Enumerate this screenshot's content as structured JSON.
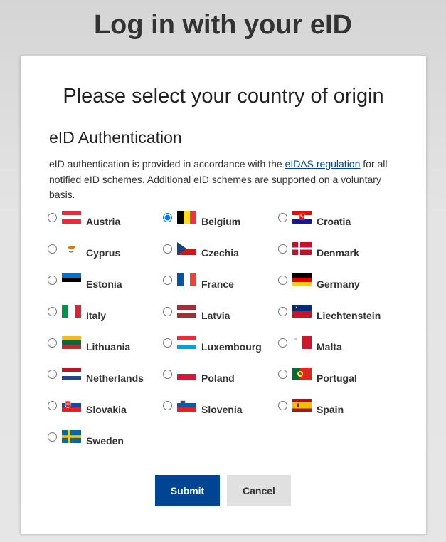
{
  "header": {
    "title": "Log in with your eID"
  },
  "card": {
    "heading": "Please select your country of origin",
    "section_title": "eID Authentication",
    "intro": {
      "before_link": "eID authentication is provided in accordance with the ",
      "link_text": "eIDAS regulation",
      "after_link": " for all notified eID schemes. Additional eID schemes are supported on a voluntary basis."
    }
  },
  "countries": [
    {
      "name": "Austria",
      "flag": "austria-flag",
      "selected": false
    },
    {
      "name": "Belgium",
      "flag": "belgium-flag",
      "selected": true
    },
    {
      "name": "Croatia",
      "flag": "croatia-flag",
      "selected": false
    },
    {
      "name": "Cyprus",
      "flag": "cyprus-flag",
      "selected": false
    },
    {
      "name": "Czechia",
      "flag": "czechia-flag",
      "selected": false
    },
    {
      "name": "Denmark",
      "flag": "denmark-flag",
      "selected": false
    },
    {
      "name": "Estonia",
      "flag": "estonia-flag",
      "selected": false
    },
    {
      "name": "France",
      "flag": "france-flag",
      "selected": false
    },
    {
      "name": "Germany",
      "flag": "germany-flag",
      "selected": false
    },
    {
      "name": "Italy",
      "flag": "italy-flag",
      "selected": false
    },
    {
      "name": "Latvia",
      "flag": "latvia-flag",
      "selected": false
    },
    {
      "name": "Liechtenstein",
      "flag": "liechtenstein-flag",
      "selected": false
    },
    {
      "name": "Lithuania",
      "flag": "lithuania-flag",
      "selected": false
    },
    {
      "name": "Luxembourg",
      "flag": "luxembourg-flag",
      "selected": false
    },
    {
      "name": "Malta",
      "flag": "malta-flag",
      "selected": false
    },
    {
      "name": "Netherlands",
      "flag": "netherlands-flag",
      "selected": false
    },
    {
      "name": "Poland",
      "flag": "poland-flag",
      "selected": false
    },
    {
      "name": "Portugal",
      "flag": "portugal-flag",
      "selected": false
    },
    {
      "name": "Slovakia",
      "flag": "slovakia-flag",
      "selected": false
    },
    {
      "name": "Slovenia",
      "flag": "slovenia-flag",
      "selected": false
    },
    {
      "name": "Spain",
      "flag": "spain-flag",
      "selected": false
    },
    {
      "name": "Sweden",
      "flag": "sweden-flag",
      "selected": false
    }
  ],
  "buttons": {
    "submit": "Submit",
    "cancel": "Cancel"
  },
  "colors": {
    "primary": "#004494",
    "cancel_bg": "#e0e0e0",
    "link": "#004494"
  }
}
